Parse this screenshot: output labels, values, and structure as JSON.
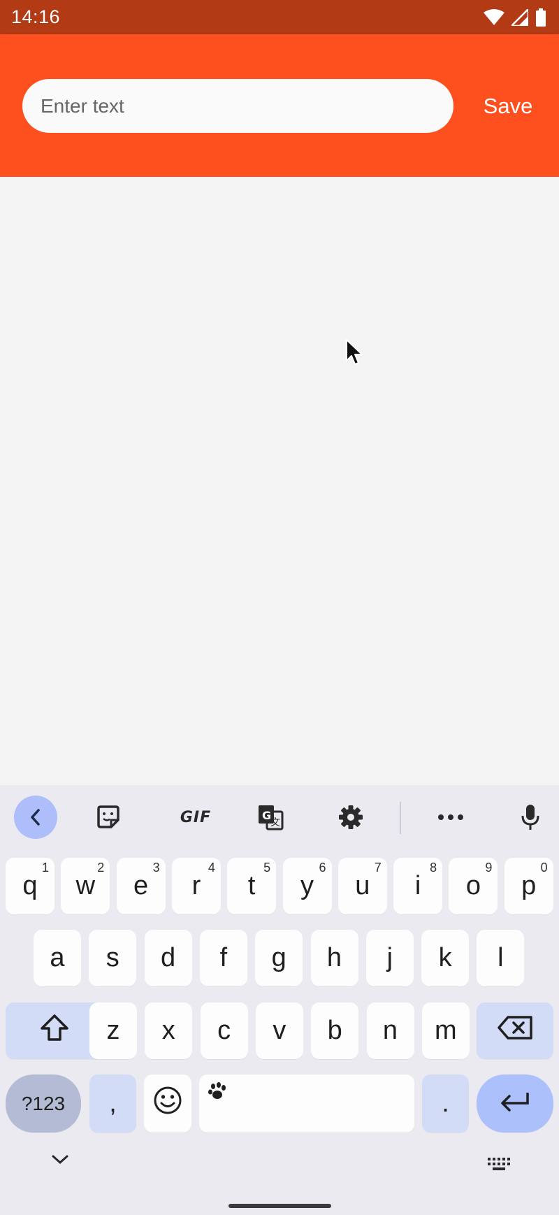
{
  "status_bar": {
    "time": "14:16",
    "icons": [
      "wifi-icon",
      "signal-icon",
      "battery-icon"
    ],
    "background": "#b23a14"
  },
  "app_bar": {
    "background": "#fe4f1e",
    "input_placeholder": "Enter text",
    "input_value": "",
    "save_label": "Save"
  },
  "keyboard": {
    "toolbar": [
      "back-chevron-icon",
      "sticker-icon",
      "GIF",
      "translate-icon",
      "settings-icon",
      "more-icon",
      "microphone-icon"
    ],
    "gif_label": "GIF",
    "row1": [
      {
        "label": "q",
        "hint": "1"
      },
      {
        "label": "w",
        "hint": "2"
      },
      {
        "label": "e",
        "hint": "3"
      },
      {
        "label": "r",
        "hint": "4"
      },
      {
        "label": "t",
        "hint": "5"
      },
      {
        "label": "y",
        "hint": "6"
      },
      {
        "label": "u",
        "hint": "7"
      },
      {
        "label": "i",
        "hint": "8"
      },
      {
        "label": "o",
        "hint": "9"
      },
      {
        "label": "p",
        "hint": "0"
      }
    ],
    "row2": [
      "a",
      "s",
      "d",
      "f",
      "g",
      "h",
      "j",
      "k",
      "l"
    ],
    "row3": [
      "z",
      "x",
      "c",
      "v",
      "b",
      "n",
      "m"
    ],
    "symbols_label": "?123",
    "comma_label": ",",
    "period_label": ".",
    "accent_color": "#acc0fb"
  }
}
